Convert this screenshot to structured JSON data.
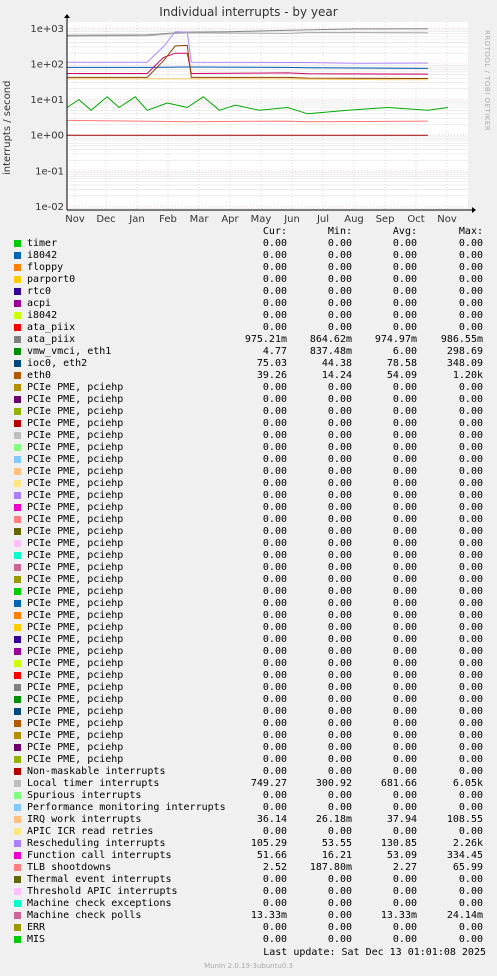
{
  "title": "Individual interrupts - by year",
  "side_text": "RRDTOOL / TOBI OETIKER",
  "ylabel": "interrupts / second",
  "headers": {
    "cur": "Cur:",
    "min": "Min:",
    "avg": "Avg:",
    "max": "Max:"
  },
  "footer": {
    "update": "Last update:  Sat Dec 13 01:01:08 2025",
    "munin": "Munin 2.0.19-3ubuntu0.3"
  },
  "chart_data": {
    "type": "line",
    "yscale": "log",
    "ylim": [
      0.008,
      1500
    ],
    "yticks": [
      {
        "v": 1000,
        "t": "1e+03"
      },
      {
        "v": 100,
        "t": "1e+02"
      },
      {
        "v": 10,
        "t": "1e+01"
      },
      {
        "v": 1,
        "t": "1e+00"
      },
      {
        "v": 0.1,
        "t": "1e-01"
      },
      {
        "v": 0.01,
        "t": "1e-02"
      }
    ],
    "xticks": [
      "Nov",
      "Dec",
      "Jan",
      "Feb",
      "Mar",
      "Apr",
      "May",
      "Jun",
      "Jul",
      "Aug",
      "Sep",
      "Oct",
      "Nov"
    ],
    "grid": true,
    "series": [
      {
        "name": "ata_piix",
        "color": "#888888",
        "points": [
          [
            0,
            640
          ],
          [
            0.2,
            650
          ],
          [
            0.25,
            720
          ],
          [
            0.3,
            780
          ],
          [
            0.4,
            800
          ],
          [
            0.6,
            900
          ],
          [
            0.72,
            960
          ],
          [
            0.9,
            975
          ]
        ]
      },
      {
        "name": "Local timer interrupts",
        "color": "#aaaaaa",
        "points": [
          [
            0,
            600
          ],
          [
            0.2,
            620
          ],
          [
            0.25,
            690
          ],
          [
            0.3,
            750
          ],
          [
            0.55,
            720
          ],
          [
            0.6,
            760
          ],
          [
            0.72,
            760
          ],
          [
            0.9,
            750
          ]
        ]
      },
      {
        "name": "Rescheduling interrupts",
        "color": "#aa88ff",
        "points": [
          [
            0,
            112
          ],
          [
            0.2,
            112
          ],
          [
            0.24,
            300
          ],
          [
            0.27,
            800
          ],
          [
            0.3,
            780
          ],
          [
            0.31,
            112
          ],
          [
            0.55,
            110
          ],
          [
            0.6,
            110
          ],
          [
            0.72,
            105
          ],
          [
            0.9,
            106
          ]
        ]
      },
      {
        "name": "ioc0, eth2",
        "color": "#0055aa",
        "points": [
          [
            0,
            80
          ],
          [
            0.2,
            80
          ],
          [
            0.3,
            82
          ],
          [
            0.55,
            80
          ],
          [
            0.6,
            78
          ],
          [
            0.9,
            75
          ]
        ]
      },
      {
        "name": "Function call interrupts",
        "color": "#cc0066",
        "points": [
          [
            0,
            54
          ],
          [
            0.2,
            54
          ],
          [
            0.24,
            150
          ],
          [
            0.27,
            200
          ],
          [
            0.3,
            200
          ],
          [
            0.31,
            54
          ],
          [
            0.55,
            56
          ],
          [
            0.6,
            53
          ],
          [
            0.9,
            52
          ]
        ]
      },
      {
        "name": "eth0",
        "color": "#884400",
        "points": [
          [
            0,
            42
          ],
          [
            0.2,
            42
          ],
          [
            0.24,
            120
          ],
          [
            0.27,
            320
          ],
          [
            0.3,
            330
          ],
          [
            0.31,
            42
          ],
          [
            0.55,
            42
          ],
          [
            0.6,
            40
          ],
          [
            0.9,
            39
          ]
        ]
      },
      {
        "name": "IRQ work interrupts",
        "color": "#ffcc66",
        "points": [
          [
            0,
            38
          ],
          [
            0.2,
            38
          ],
          [
            0.3,
            38
          ],
          [
            0.55,
            38
          ],
          [
            0.6,
            37
          ],
          [
            0.9,
            36
          ]
        ]
      },
      {
        "name": "vmw_vmci, eth1",
        "color": "#00aa00",
        "points": [
          [
            0,
            6
          ],
          [
            0.03,
            10
          ],
          [
            0.06,
            5
          ],
          [
            0.1,
            12
          ],
          [
            0.13,
            6
          ],
          [
            0.17,
            12
          ],
          [
            0.2,
            5
          ],
          [
            0.25,
            8
          ],
          [
            0.3,
            6
          ],
          [
            0.34,
            12
          ],
          [
            0.38,
            5
          ],
          [
            0.42,
            7
          ],
          [
            0.48,
            5
          ],
          [
            0.55,
            6
          ],
          [
            0.6,
            4
          ],
          [
            0.7,
            5
          ],
          [
            0.8,
            6
          ],
          [
            0.9,
            5
          ],
          [
            0.95,
            6
          ]
        ]
      },
      {
        "name": "TLB shootdowns",
        "color": "#ff7777",
        "points": [
          [
            0,
            2.6
          ],
          [
            0.3,
            2.4
          ],
          [
            0.55,
            2.5
          ],
          [
            0.6,
            2.4
          ],
          [
            0.9,
            2.5
          ]
        ]
      },
      {
        "name": "Non-maskable interrupts",
        "color": "#990000",
        "points": [
          [
            0,
            1
          ],
          [
            0.9,
            1
          ]
        ]
      }
    ]
  },
  "legend": [
    {
      "label": "timer",
      "color": "#00cc00",
      "cur": "0.00",
      "min": "0.00",
      "avg": "0.00",
      "max": "0.00"
    },
    {
      "label": "i8042",
      "color": "#0066b3",
      "cur": "0.00",
      "min": "0.00",
      "avg": "0.00",
      "max": "0.00"
    },
    {
      "label": "floppy",
      "color": "#ff8000",
      "cur": "0.00",
      "min": "0.00",
      "avg": "0.00",
      "max": "0.00"
    },
    {
      "label": "parport0",
      "color": "#ffcc00",
      "cur": "0.00",
      "min": "0.00",
      "avg": "0.00",
      "max": "0.00"
    },
    {
      "label": "rtc0",
      "color": "#330099",
      "cur": "0.00",
      "min": "0.00",
      "avg": "0.00",
      "max": "0.00"
    },
    {
      "label": "acpi",
      "color": "#990099",
      "cur": "0.00",
      "min": "0.00",
      "avg": "0.00",
      "max": "0.00"
    },
    {
      "label": "i8042",
      "color": "#ccff00",
      "cur": "0.00",
      "min": "0.00",
      "avg": "0.00",
      "max": "0.00"
    },
    {
      "label": "ata_piix",
      "color": "#ff0000",
      "cur": "0.00",
      "min": "0.00",
      "avg": "0.00",
      "max": "0.00"
    },
    {
      "label": "ata_piix",
      "color": "#808080",
      "cur": "975.21m",
      "min": "864.62m",
      "avg": "974.97m",
      "max": "986.55m"
    },
    {
      "label": "vmw_vmci, eth1",
      "color": "#008f00",
      "cur": "4.77",
      "min": "837.48m",
      "avg": "6.00",
      "max": "298.69"
    },
    {
      "label": "ioc0, eth2",
      "color": "#00487d",
      "cur": "75.03",
      "min": "44.38",
      "avg": "78.58",
      "max": "348.09"
    },
    {
      "label": "eth0",
      "color": "#b35a00",
      "cur": "39.26",
      "min": "14.24",
      "avg": "54.09",
      "max": "1.20k"
    },
    {
      "label": "PCIe PME, pciehp",
      "color": "#b38f00",
      "cur": "0.00",
      "min": "0.00",
      "avg": "0.00",
      "max": "0.00"
    },
    {
      "label": "PCIe PME, pciehp",
      "color": "#6b006b",
      "cur": "0.00",
      "min": "0.00",
      "avg": "0.00",
      "max": "0.00"
    },
    {
      "label": "PCIe PME, pciehp",
      "color": "#8fb300",
      "cur": "0.00",
      "min": "0.00",
      "avg": "0.00",
      "max": "0.00"
    },
    {
      "label": "PCIe PME, pciehp",
      "color": "#b30000",
      "cur": "0.00",
      "min": "0.00",
      "avg": "0.00",
      "max": "0.00"
    },
    {
      "label": "PCIe PME, pciehp",
      "color": "#bebebe",
      "cur": "0.00",
      "min": "0.00",
      "avg": "0.00",
      "max": "0.00"
    },
    {
      "label": "PCIe PME, pciehp",
      "color": "#80ff80",
      "cur": "0.00",
      "min": "0.00",
      "avg": "0.00",
      "max": "0.00"
    },
    {
      "label": "PCIe PME, pciehp",
      "color": "#80c9ff",
      "cur": "0.00",
      "min": "0.00",
      "avg": "0.00",
      "max": "0.00"
    },
    {
      "label": "PCIe PME, pciehp",
      "color": "#ffc080",
      "cur": "0.00",
      "min": "0.00",
      "avg": "0.00",
      "max": "0.00"
    },
    {
      "label": "PCIe PME, pciehp",
      "color": "#ffe680",
      "cur": "0.00",
      "min": "0.00",
      "avg": "0.00",
      "max": "0.00"
    },
    {
      "label": "PCIe PME, pciehp",
      "color": "#aa80ff",
      "cur": "0.00",
      "min": "0.00",
      "avg": "0.00",
      "max": "0.00"
    },
    {
      "label": "PCIe PME, pciehp",
      "color": "#ee00cc",
      "cur": "0.00",
      "min": "0.00",
      "avg": "0.00",
      "max": "0.00"
    },
    {
      "label": "PCIe PME, pciehp",
      "color": "#ff8080",
      "cur": "0.00",
      "min": "0.00",
      "avg": "0.00",
      "max": "0.00"
    },
    {
      "label": "PCIe PME, pciehp",
      "color": "#666600",
      "cur": "0.00",
      "min": "0.00",
      "avg": "0.00",
      "max": "0.00"
    },
    {
      "label": "PCIe PME, pciehp",
      "color": "#ffbfff",
      "cur": "0.00",
      "min": "0.00",
      "avg": "0.00",
      "max": "0.00"
    },
    {
      "label": "PCIe PME, pciehp",
      "color": "#00ffcc",
      "cur": "0.00",
      "min": "0.00",
      "avg": "0.00",
      "max": "0.00"
    },
    {
      "label": "PCIe PME, pciehp",
      "color": "#cc6699",
      "cur": "0.00",
      "min": "0.00",
      "avg": "0.00",
      "max": "0.00"
    },
    {
      "label": "PCIe PME, pciehp",
      "color": "#999900",
      "cur": "0.00",
      "min": "0.00",
      "avg": "0.00",
      "max": "0.00"
    },
    {
      "label": "PCIe PME, pciehp",
      "color": "#00cc00",
      "cur": "0.00",
      "min": "0.00",
      "avg": "0.00",
      "max": "0.00"
    },
    {
      "label": "PCIe PME, pciehp",
      "color": "#0066b3",
      "cur": "0.00",
      "min": "0.00",
      "avg": "0.00",
      "max": "0.00"
    },
    {
      "label": "PCIe PME, pciehp",
      "color": "#ff8000",
      "cur": "0.00",
      "min": "0.00",
      "avg": "0.00",
      "max": "0.00"
    },
    {
      "label": "PCIe PME, pciehp",
      "color": "#ffcc00",
      "cur": "0.00",
      "min": "0.00",
      "avg": "0.00",
      "max": "0.00"
    },
    {
      "label": "PCIe PME, pciehp",
      "color": "#330099",
      "cur": "0.00",
      "min": "0.00",
      "avg": "0.00",
      "max": "0.00"
    },
    {
      "label": "PCIe PME, pciehp",
      "color": "#990099",
      "cur": "0.00",
      "min": "0.00",
      "avg": "0.00",
      "max": "0.00"
    },
    {
      "label": "PCIe PME, pciehp",
      "color": "#ccff00",
      "cur": "0.00",
      "min": "0.00",
      "avg": "0.00",
      "max": "0.00"
    },
    {
      "label": "PCIe PME, pciehp",
      "color": "#ff0000",
      "cur": "0.00",
      "min": "0.00",
      "avg": "0.00",
      "max": "0.00"
    },
    {
      "label": "PCIe PME, pciehp",
      "color": "#808080",
      "cur": "0.00",
      "min": "0.00",
      "avg": "0.00",
      "max": "0.00"
    },
    {
      "label": "PCIe PME, pciehp",
      "color": "#008f00",
      "cur": "0.00",
      "min": "0.00",
      "avg": "0.00",
      "max": "0.00"
    },
    {
      "label": "PCIe PME, pciehp",
      "color": "#00487d",
      "cur": "0.00",
      "min": "0.00",
      "avg": "0.00",
      "max": "0.00"
    },
    {
      "label": "PCIe PME, pciehp",
      "color": "#b35a00",
      "cur": "0.00",
      "min": "0.00",
      "avg": "0.00",
      "max": "0.00"
    },
    {
      "label": "PCIe PME, pciehp",
      "color": "#b38f00",
      "cur": "0.00",
      "min": "0.00",
      "avg": "0.00",
      "max": "0.00"
    },
    {
      "label": "PCIe PME, pciehp",
      "color": "#6b006b",
      "cur": "0.00",
      "min": "0.00",
      "avg": "0.00",
      "max": "0.00"
    },
    {
      "label": "PCIe PME, pciehp",
      "color": "#8fb300",
      "cur": "0.00",
      "min": "0.00",
      "avg": "0.00",
      "max": "0.00"
    },
    {
      "label": "Non-maskable interrupts",
      "color": "#b30000",
      "cur": "0.00",
      "min": "0.00",
      "avg": "0.00",
      "max": "0.00"
    },
    {
      "label": "Local timer interrupts",
      "color": "#bebebe",
      "cur": "749.27",
      "min": "300.92",
      "avg": "681.66",
      "max": "6.05k"
    },
    {
      "label": "Spurious interrupts",
      "color": "#80ff80",
      "cur": "0.00",
      "min": "0.00",
      "avg": "0.00",
      "max": "0.00"
    },
    {
      "label": "Performance monitoring interrupts",
      "color": "#80c9ff",
      "cur": "0.00",
      "min": "0.00",
      "avg": "0.00",
      "max": "0.00"
    },
    {
      "label": "IRQ work interrupts",
      "color": "#ffc080",
      "cur": "36.14",
      "min": "26.18m",
      "avg": "37.94",
      "max": "108.55"
    },
    {
      "label": "APIC ICR read retries",
      "color": "#ffe680",
      "cur": "0.00",
      "min": "0.00",
      "avg": "0.00",
      "max": "0.00"
    },
    {
      "label": "Rescheduling interrupts",
      "color": "#aa80ff",
      "cur": "105.29",
      "min": "53.55",
      "avg": "130.85",
      "max": "2.26k"
    },
    {
      "label": "Function call interrupts",
      "color": "#ee00cc",
      "cur": "51.66",
      "min": "16.21",
      "avg": "53.09",
      "max": "334.45"
    },
    {
      "label": "TLB shootdowns",
      "color": "#ff8080",
      "cur": "2.52",
      "min": "187.80m",
      "avg": "2.27",
      "max": "65.99"
    },
    {
      "label": "Thermal event interrupts",
      "color": "#666600",
      "cur": "0.00",
      "min": "0.00",
      "avg": "0.00",
      "max": "0.00"
    },
    {
      "label": "Threshold APIC interrupts",
      "color": "#ffbfff",
      "cur": "0.00",
      "min": "0.00",
      "avg": "0.00",
      "max": "0.00"
    },
    {
      "label": "Machine check exceptions",
      "color": "#00ffcc",
      "cur": "0.00",
      "min": "0.00",
      "avg": "0.00",
      "max": "0.00"
    },
    {
      "label": "Machine check polls",
      "color": "#cc6699",
      "cur": "13.33m",
      "min": "0.00",
      "avg": "13.33m",
      "max": "24.14m"
    },
    {
      "label": "ERR",
      "color": "#999900",
      "cur": "0.00",
      "min": "0.00",
      "avg": "0.00",
      "max": "0.00"
    },
    {
      "label": "MIS",
      "color": "#00cc00",
      "cur": "0.00",
      "min": "0.00",
      "avg": "0.00",
      "max": "0.00"
    }
  ]
}
